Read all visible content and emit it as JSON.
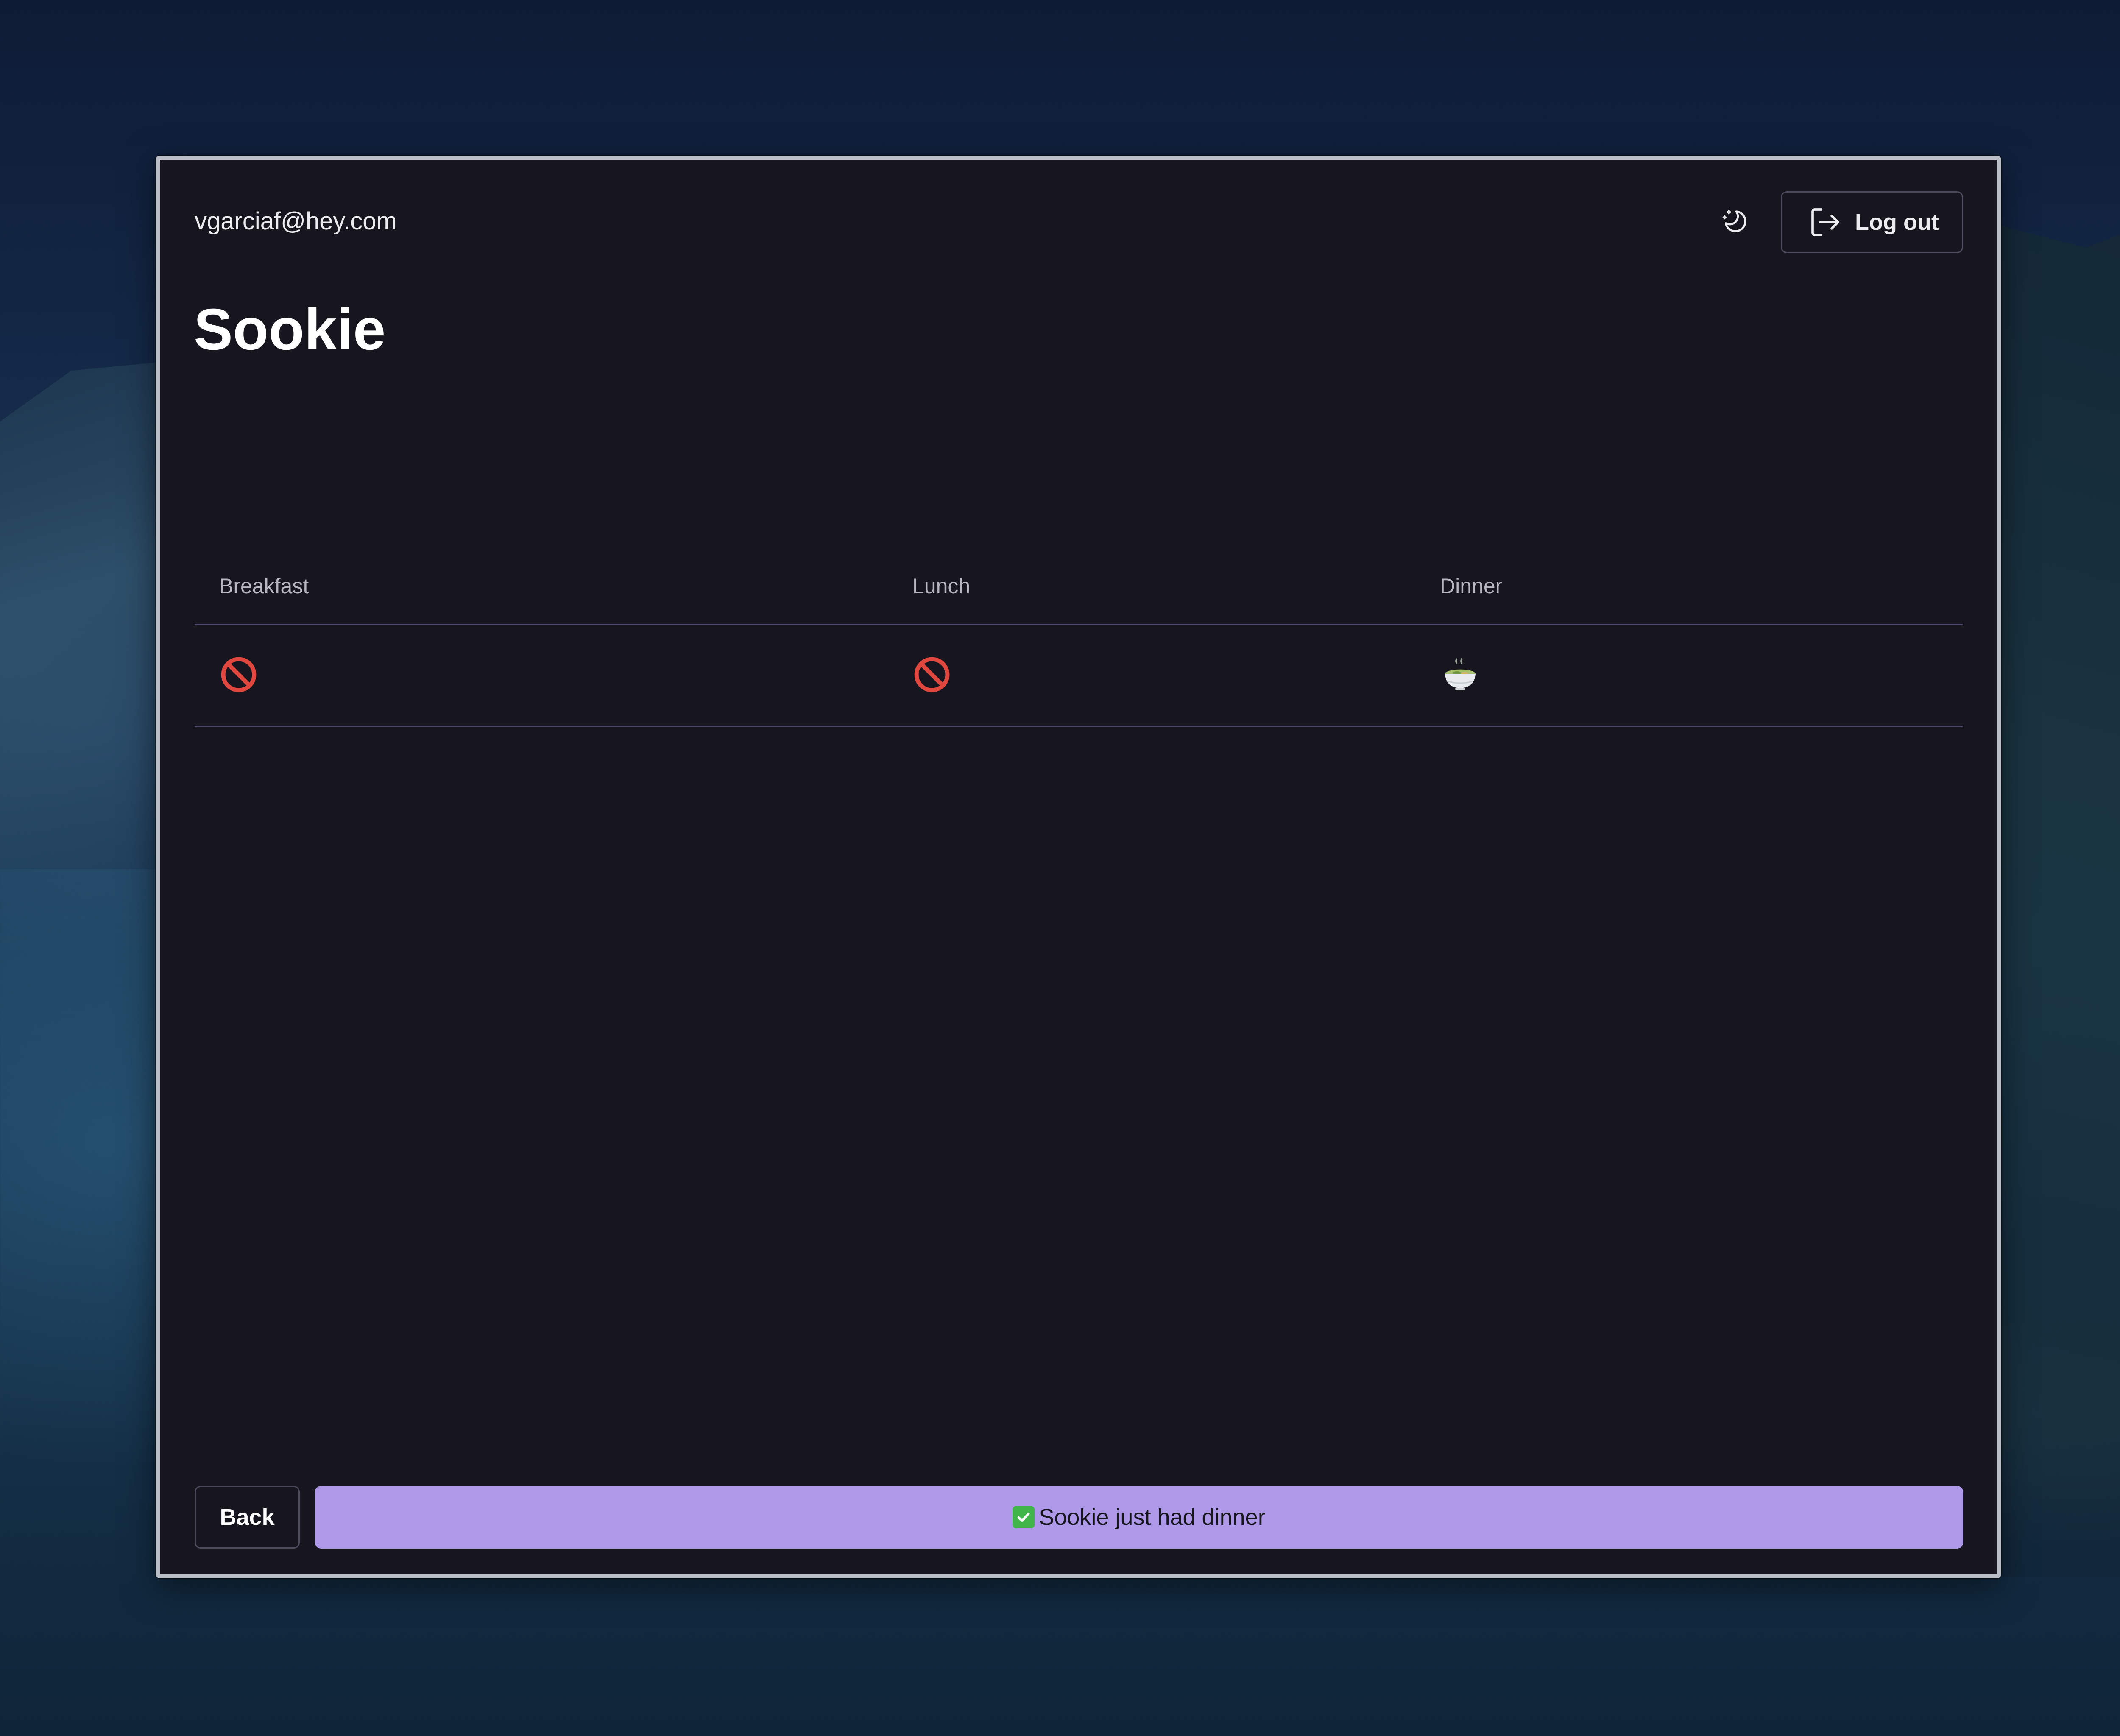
{
  "header": {
    "email": "vgarciaf@hey.com",
    "theme_icon": "moon-stars-icon",
    "logout_icon": "logout-icon",
    "logout_label": "Log out"
  },
  "page": {
    "title": "Sookie"
  },
  "meals_table": {
    "columns": [
      "Breakfast",
      "Lunch",
      "Dinner"
    ],
    "row": [
      {
        "meal": "Breakfast",
        "status_icon": "prohibited-icon"
      },
      {
        "meal": "Lunch",
        "status_icon": "prohibited-icon"
      },
      {
        "meal": "Dinner",
        "status_icon": "food-bowl-icon"
      }
    ]
  },
  "footer": {
    "back_label": "Back",
    "action_icon": "check-mark-icon",
    "action_label": "Sookie just had dinner"
  },
  "colors": {
    "window_background": "#17161e",
    "accent": "#ae99e9",
    "divider": "#4f4a68",
    "prohibited": "#e0473f",
    "check": "#3fb54a"
  }
}
